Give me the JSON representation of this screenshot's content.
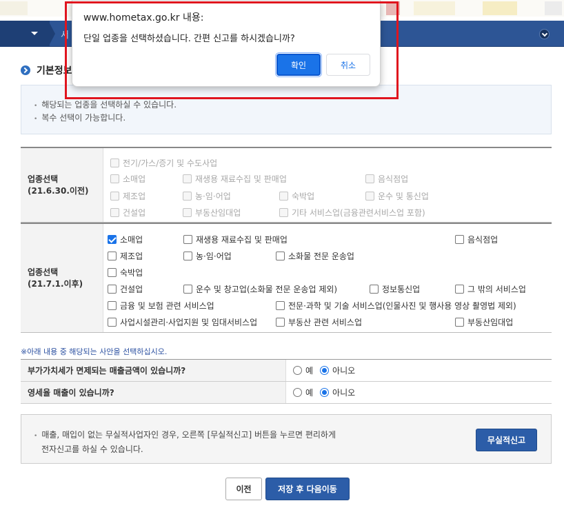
{
  "nav": {
    "second_item": "서"
  },
  "section": {
    "title": "기본정보"
  },
  "info": {
    "lines": [
      "해당되는 업종을 선택하실 수 있습니다.",
      "복수 선택이 가능합니다."
    ]
  },
  "old_industry": {
    "header_line1": "업종선택",
    "header_line2": "(21.6.30.이전)",
    "items": [
      "전기/가스/증기 및 수도사업",
      "소매업",
      "재생용 재료수집 및 판매업",
      "음식점업",
      "제조업",
      "농·임·어업",
      "숙박업",
      "운수 및 통신업",
      "건설업",
      "부동산임대업",
      "기타 서비스업(금융관련서비스업 포함)"
    ]
  },
  "new_industry": {
    "header_line1": "업종선택",
    "header_line2": "(21.7.1.이후)",
    "items": [
      "소매업",
      "재생용 재료수집 및 판매업",
      "음식점업",
      "제조업",
      "농·임·어업",
      "소화물 전문 운송업",
      "숙박업",
      "건설업",
      "운수 및 창고업(소화물 전문 운송업 제외)",
      "정보통신업",
      "그 밖의 서비스업",
      "금융 및 보험 관련 서비스업",
      "전문·과학 및 기술 서비스업(인물사진 및 행사용 영상 촬영법 제외)",
      "사업시설관리·사업지원 및 임대서비스업",
      "부동산 관련 서비스업",
      "부동산임대업"
    ],
    "checked": [
      "소매업"
    ]
  },
  "notice": "※아래 내용 중 해당되는 사안을 선택하십시오.",
  "questions": [
    {
      "label": "부가가치세가 면제되는 매출금액이 있습니까?",
      "yes": "예",
      "no": "아니오",
      "selected": "아니오"
    },
    {
      "label": "영세율 매출이 있습니까?",
      "yes": "예",
      "no": "아니오",
      "selected": "아니오"
    }
  ],
  "bottom": {
    "line1": "매출, 매입이 없는 무실적사업자인 경우, 오른쪽 [무실적신고] 버튼을 누르면 편리하게",
    "line2": "전자신고를 하실 수 있습니다.",
    "no_report_button": "무실적신고"
  },
  "buttons": {
    "prev": "이전",
    "next": "저장 후 다음이동"
  },
  "dialog": {
    "title": "www.hometax.go.kr 내용:",
    "message": "단일 업종을 선택하셨습니다. 간편 신고를 하시겠습니까?",
    "ok": "확인",
    "cancel": "취소"
  },
  "colors": {
    "nav": "#2d5595",
    "primary_button": "#2c5da8",
    "dialog_ok": "#1a73e8",
    "highlight_frame": "#e0141e"
  }
}
